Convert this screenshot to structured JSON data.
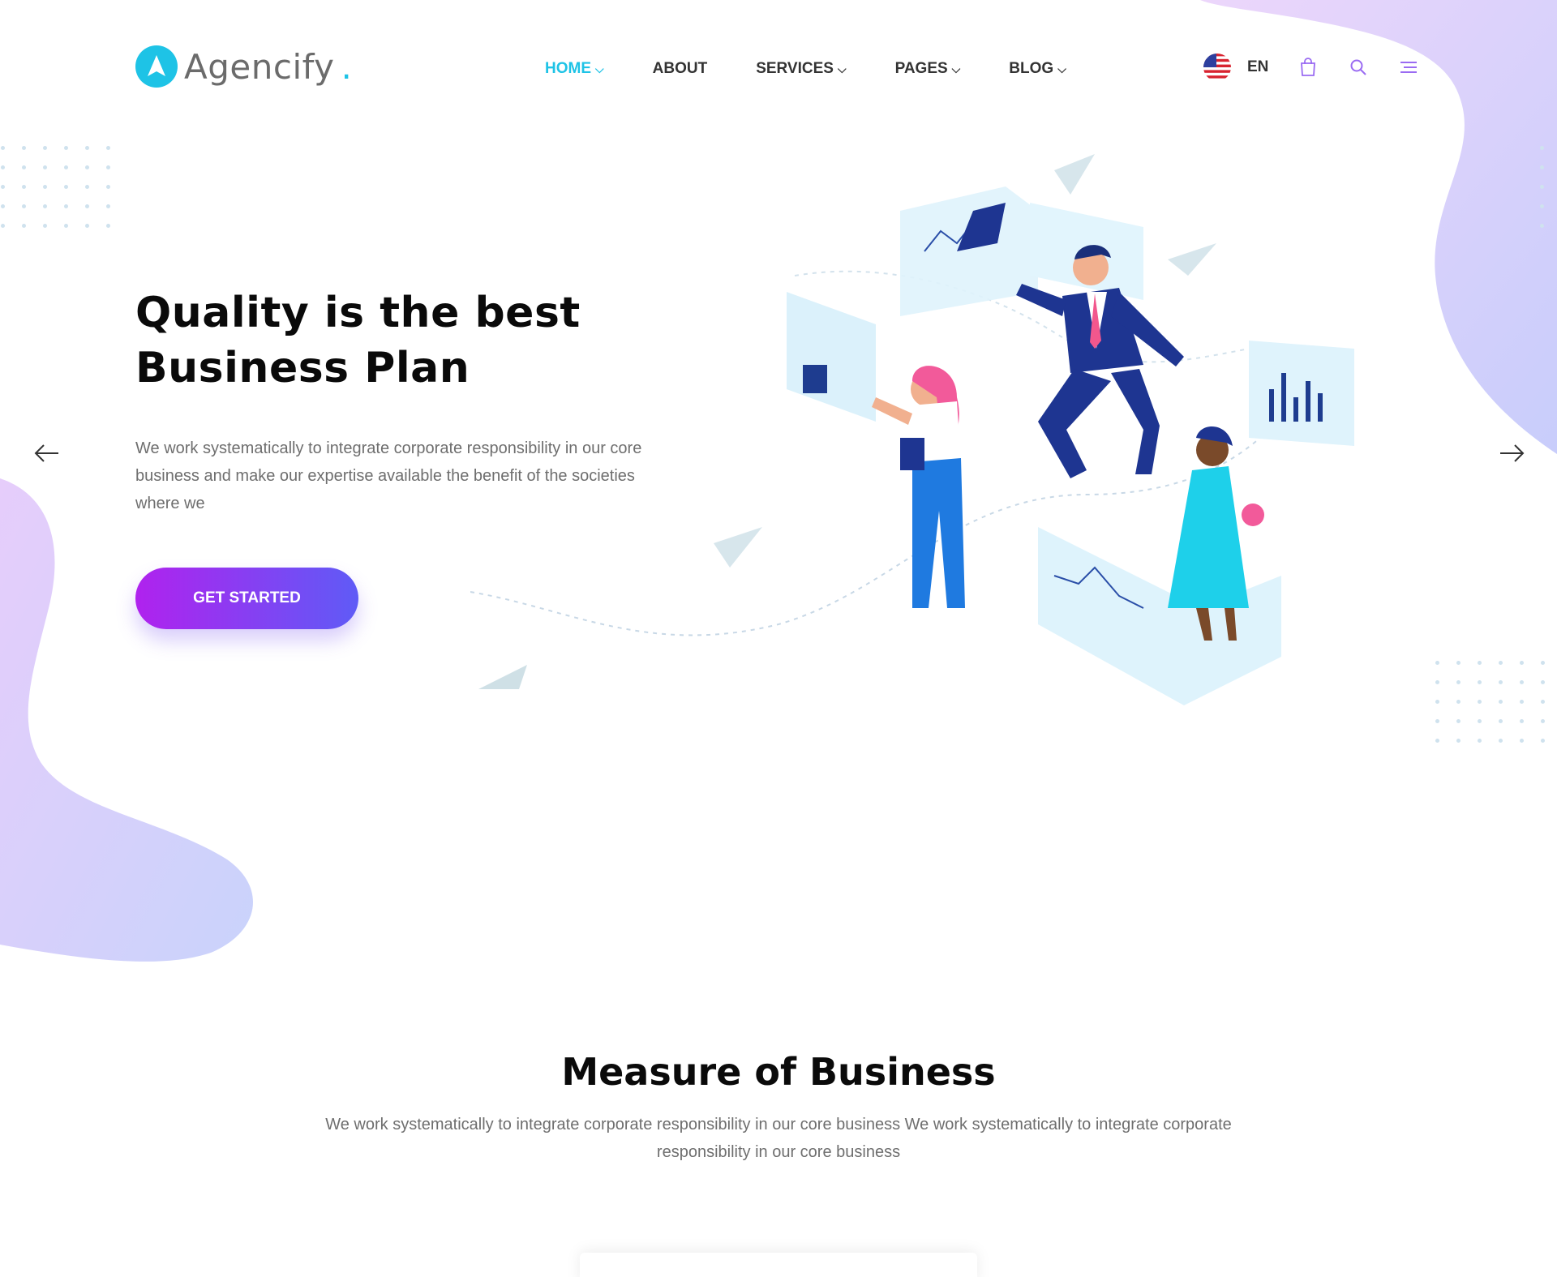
{
  "brand": {
    "name": "Agencify",
    "dot": ".",
    "accent": "#1ec3e6"
  },
  "nav": {
    "items": [
      {
        "label": "HOME",
        "active": true,
        "dropdown": true
      },
      {
        "label": "ABOUT",
        "active": false,
        "dropdown": false
      },
      {
        "label": "SERVICES",
        "active": false,
        "dropdown": true
      },
      {
        "label": "PAGES",
        "active": false,
        "dropdown": true
      },
      {
        "label": "BLOG",
        "active": false,
        "dropdown": true
      }
    ],
    "caret": "⌵"
  },
  "header_right": {
    "language": "EN",
    "icons": [
      "us-flag-icon",
      "shopping-bag-icon",
      "search-icon",
      "menu-icon"
    ]
  },
  "hero": {
    "title_line1": "Quality is the best",
    "title_line2": "Business Plan",
    "text": "We work systematically to integrate corporate responsibility in our core business and make our expertise available the benefit of the societies where we",
    "cta_label": "GET STARTED",
    "cta_gradient": [
      "#b022ee",
      "#5f5bf6"
    ],
    "prev_icon": "arrow-left-icon",
    "next_icon": "arrow-right-icon"
  },
  "section": {
    "title": "Measure of Business",
    "text": "We work systematically to integrate corporate responsibility in our core business We work systematically to integrate corporate responsibility in our core business"
  },
  "colors": {
    "blob": "#d8c8fb",
    "blob2": "#c6d4fb",
    "title": "#0a0a0a",
    "body_text": "#6e6e6e"
  }
}
